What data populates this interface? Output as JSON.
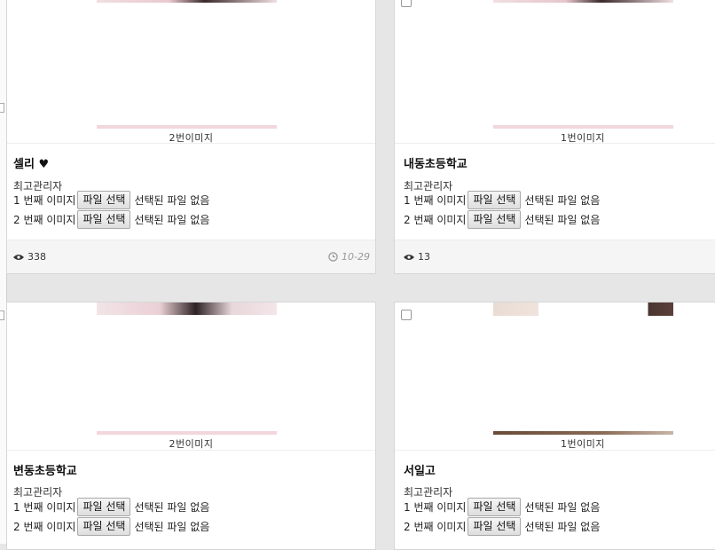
{
  "cards": [
    {
      "caption": "2번이미지",
      "title": "셀리 ♥",
      "author": "최고관리자",
      "upload1_label": "1 번째 이미지",
      "upload2_label": "2 번째 이미지",
      "file_button": "파일 선택",
      "no_file": "선택된 파일 없음",
      "views": "338",
      "date": "10-29"
    },
    {
      "caption": "1번이미지",
      "title": "내동초등학교",
      "author": "최고관리자",
      "upload1_label": "1 번째 이미지",
      "upload2_label": "2 번째 이미지",
      "file_button": "파일 선택",
      "no_file": "선택된 파일 없음",
      "views": "13"
    },
    {
      "caption": "2번이미지",
      "title": "변동초등학교",
      "author": "최고관리자",
      "upload1_label": "1 번째 이미지",
      "upload2_label": "2 번째 이미지",
      "file_button": "파일 선택",
      "no_file": "선택된 파일 없음"
    },
    {
      "caption": "1번이미지",
      "title": "서일고",
      "author": "최고관리자",
      "upload1_label": "1 번째 이미지",
      "upload2_label": "2 번째 이미지",
      "file_button": "파일 선택",
      "no_file": "선택된 파일 없음"
    }
  ]
}
